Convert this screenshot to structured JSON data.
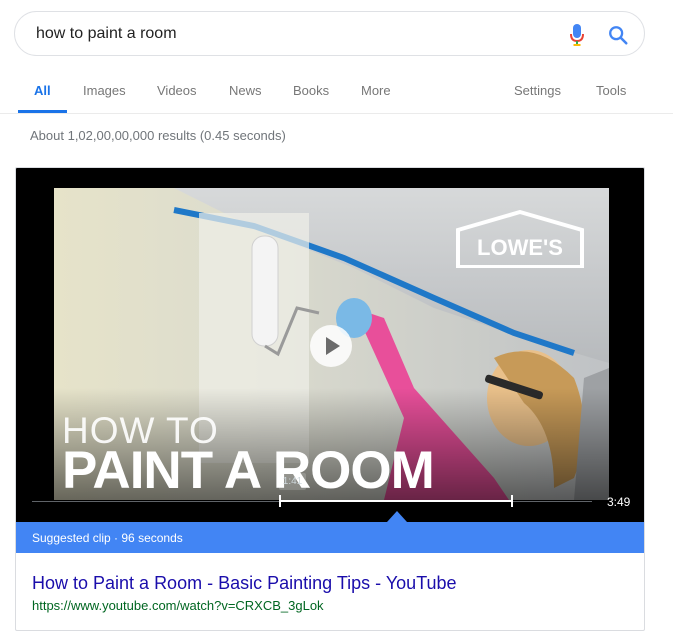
{
  "search": {
    "query": "how to paint a room"
  },
  "tabs": [
    {
      "label": "All",
      "active": true
    },
    {
      "label": "Images"
    },
    {
      "label": "Videos"
    },
    {
      "label": "News"
    },
    {
      "label": "Books"
    },
    {
      "label": "More"
    },
    {
      "label": "Settings"
    },
    {
      "label": "Tools"
    }
  ],
  "result_stats": "About 1,02,00,00,000 results (0.45 seconds)",
  "video": {
    "brand_logo_text": "LOWE'S",
    "overlay_line1": "HOW TO",
    "overlay_line2": "PAINT A ROOM",
    "clip_start_label": "1:41",
    "duration": "3:49",
    "suggested_clip_label": "Suggested clip · 96 seconds",
    "title": "How to Paint a Room - Basic Painting Tips - YouTube",
    "url": "https://www.youtube.com/watch?v=CRXCB_3gLok"
  },
  "colors": {
    "accent_blue": "#1a73e8",
    "clip_bar_blue": "#4285f4",
    "link_title": "#1a0dab",
    "link_url": "#006621"
  },
  "icons": [
    "mic-icon",
    "search-icon",
    "play-icon",
    "brand-logo"
  ]
}
